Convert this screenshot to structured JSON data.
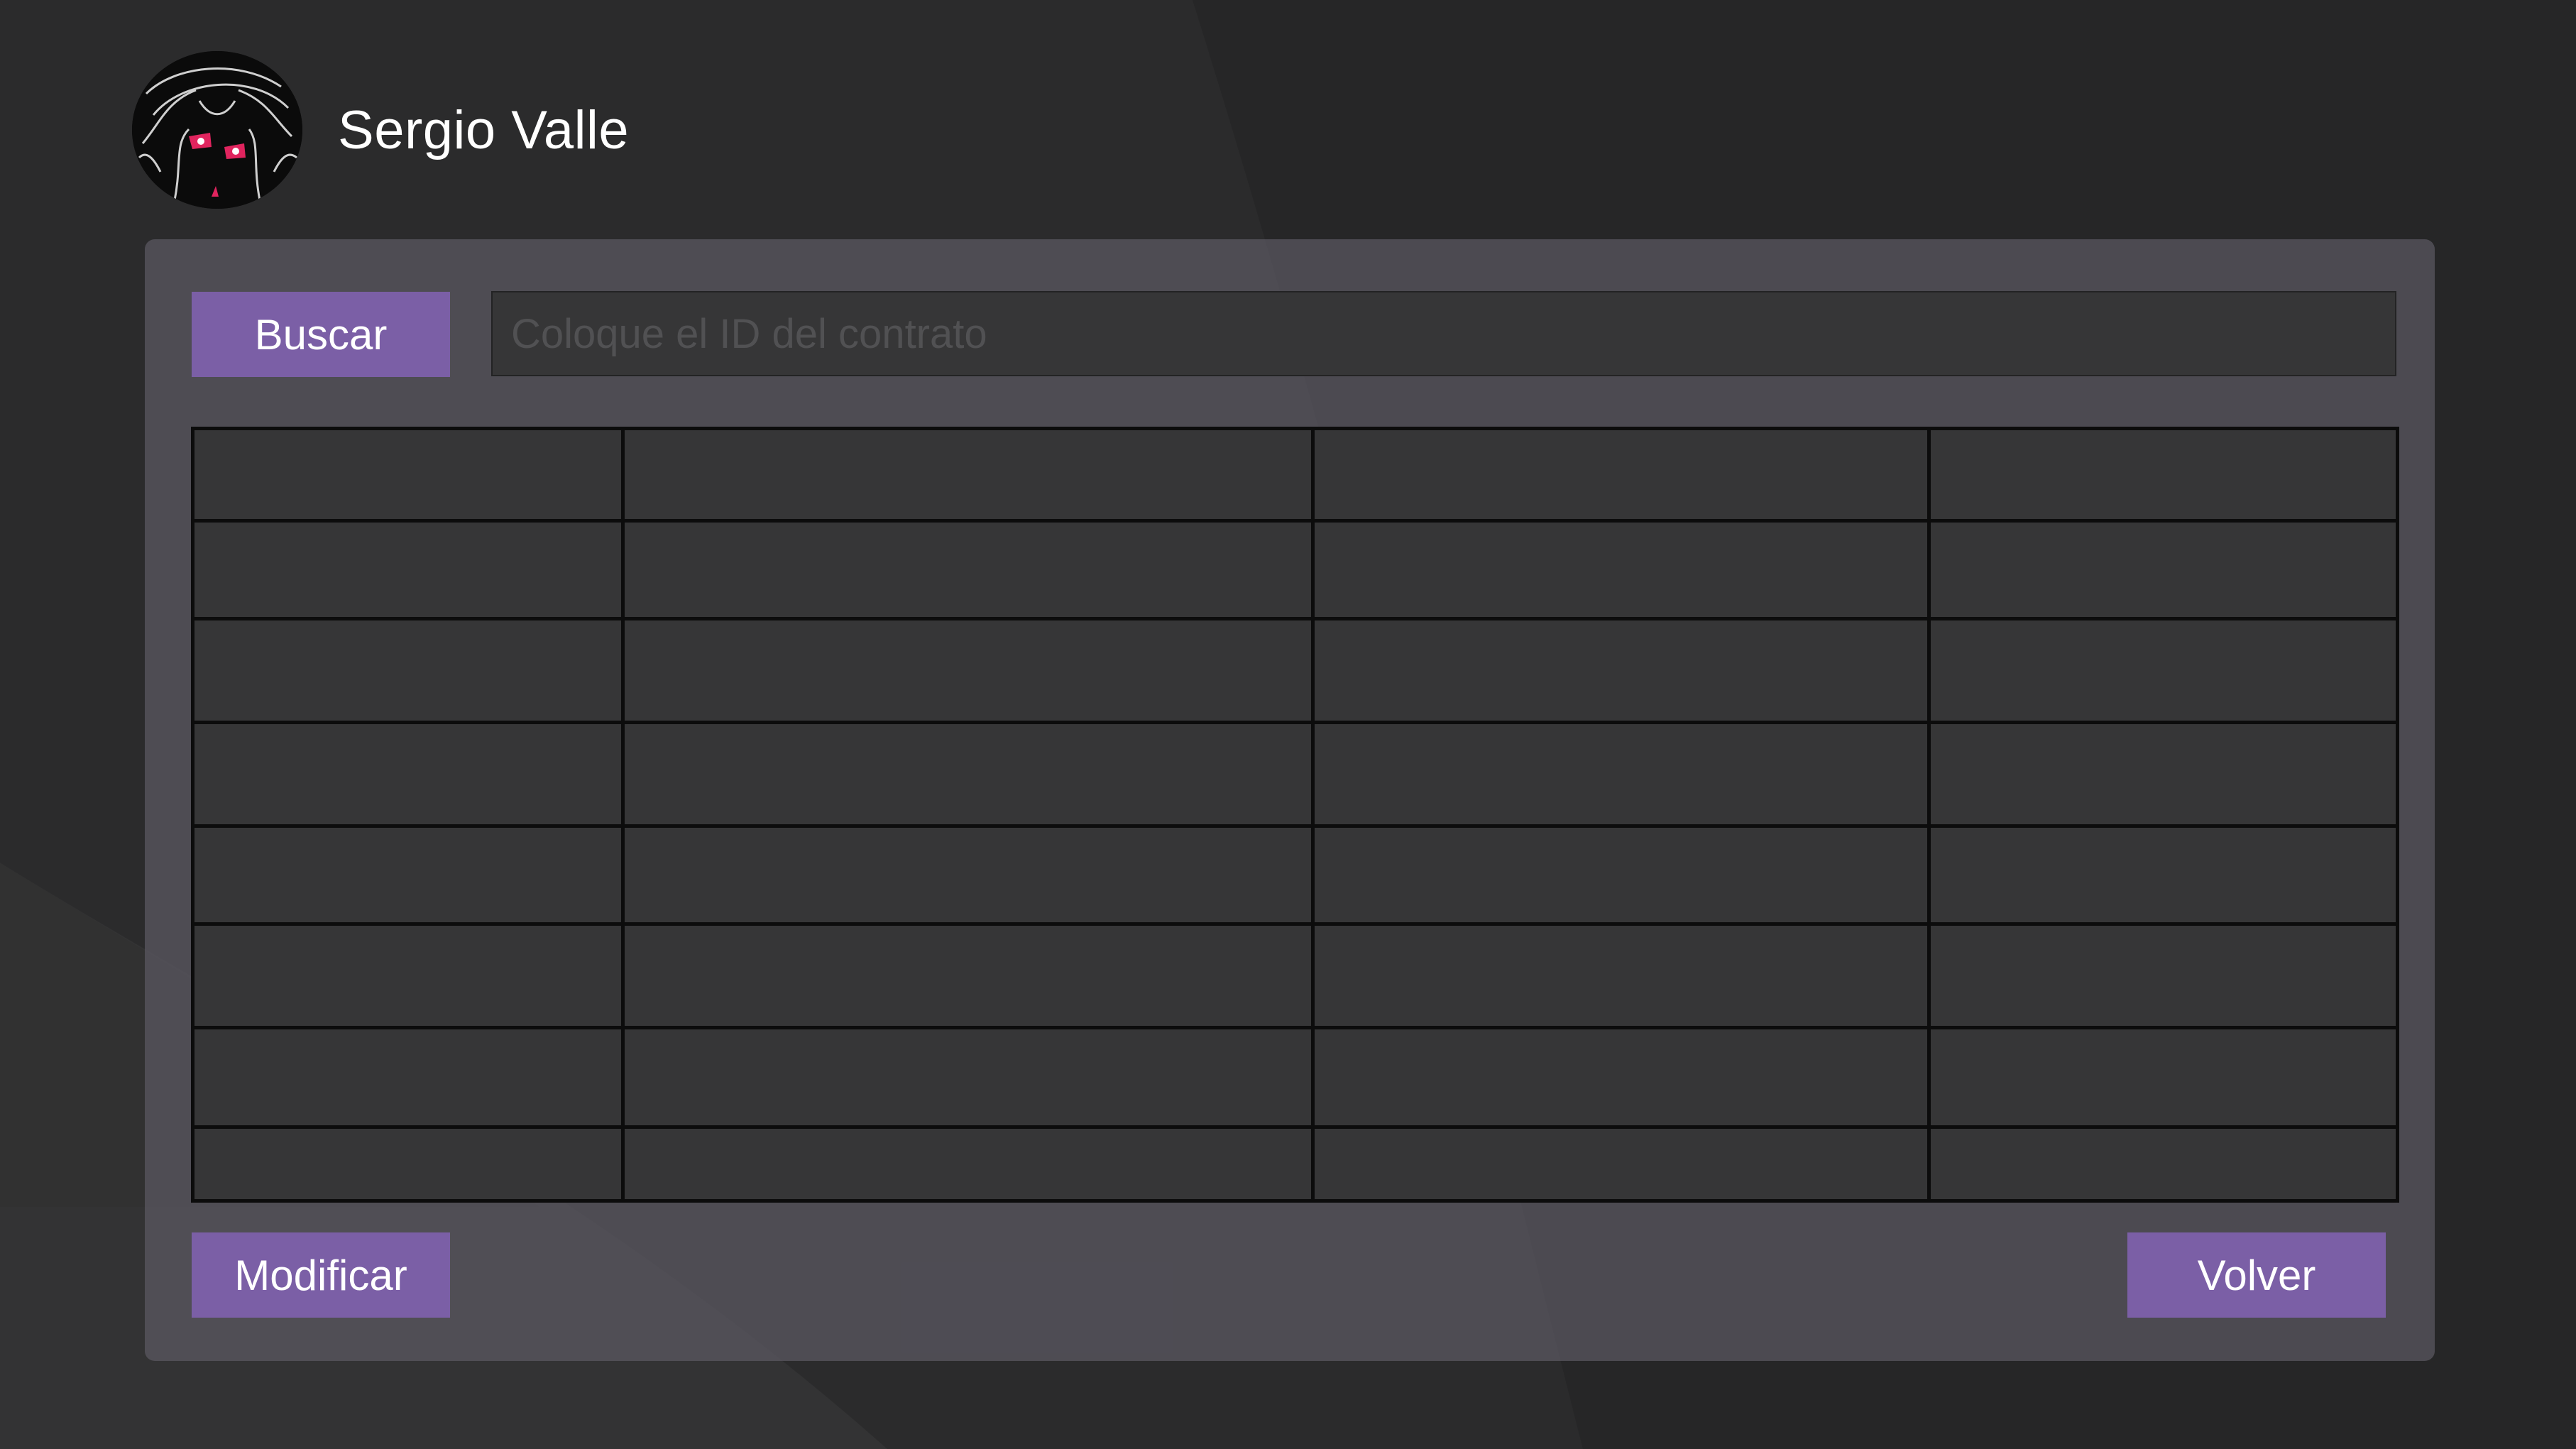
{
  "app": {
    "background_color": "#2b2b2c",
    "accent_color": "#7b5fa6"
  },
  "header": {
    "avatar_icon": "anime-character-avatar",
    "user_name": "Sergio Valle"
  },
  "search": {
    "button_label": "Buscar",
    "input_value": "",
    "input_placeholder": "Coloque el ID del contrato"
  },
  "table": {
    "column_count": 4,
    "row_count": 8,
    "columns": [
      "",
      "",
      "",
      ""
    ],
    "rows": [
      [
        "",
        "",
        "",
        ""
      ],
      [
        "",
        "",
        "",
        ""
      ],
      [
        "",
        "",
        "",
        ""
      ],
      [
        "",
        "",
        "",
        ""
      ],
      [
        "",
        "",
        "",
        ""
      ],
      [
        "",
        "",
        "",
        ""
      ],
      [
        "",
        "",
        "",
        ""
      ]
    ]
  },
  "actions": {
    "modify_label": "Modificar",
    "back_label": "Volver"
  }
}
